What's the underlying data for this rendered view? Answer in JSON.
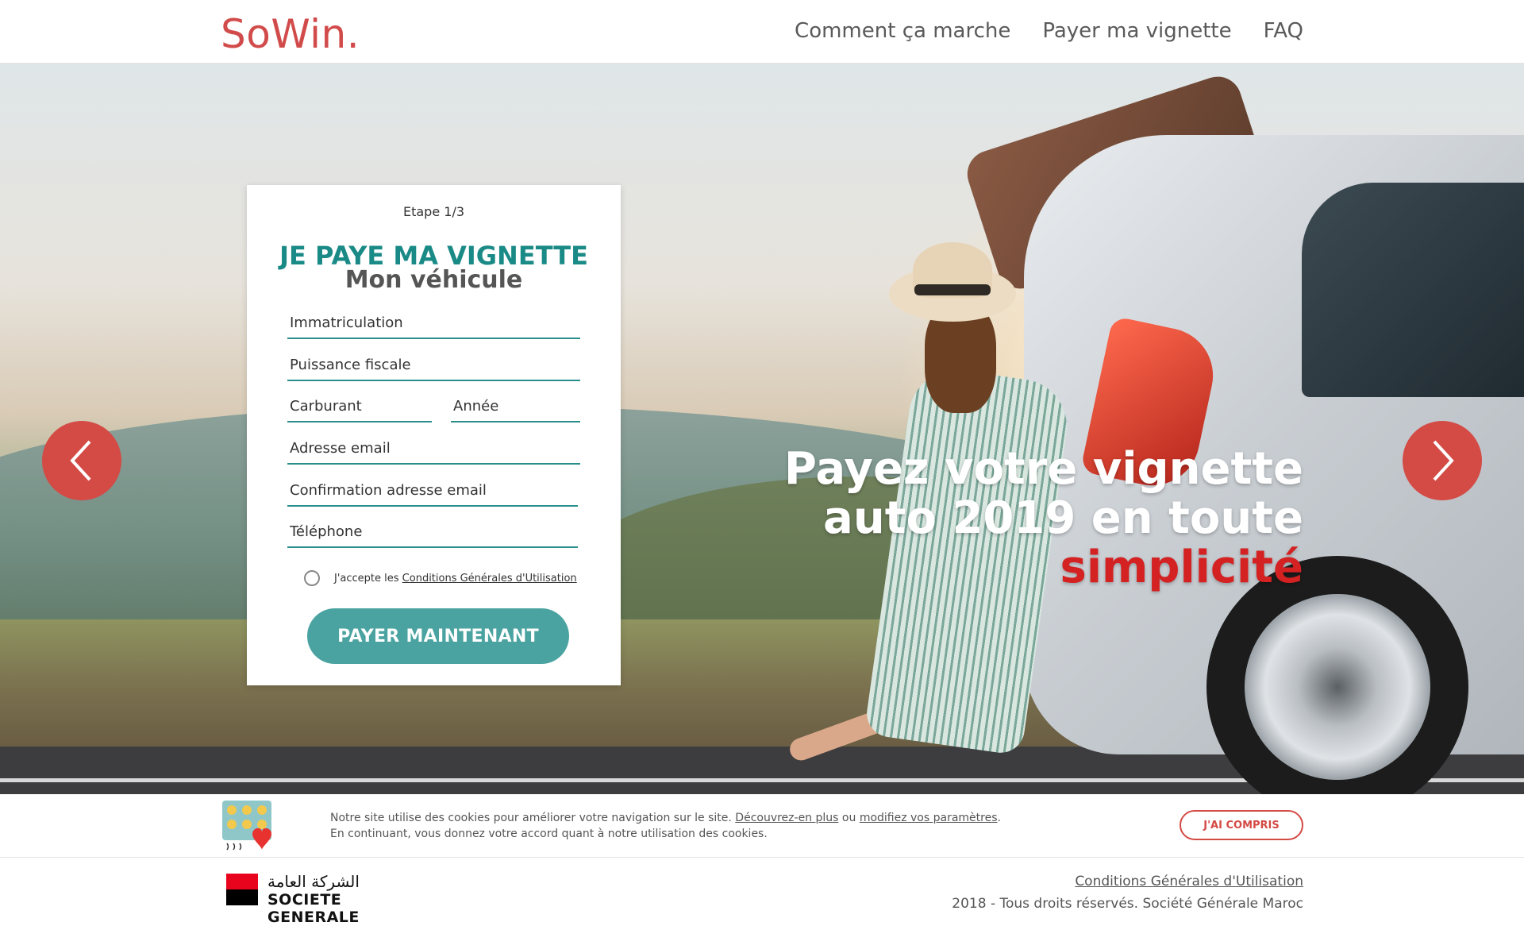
{
  "header": {
    "logo": "SoWin.",
    "nav": [
      "Comment ça marche",
      "Payer ma vignette",
      "FAQ"
    ]
  },
  "form": {
    "step": "Etape 1/3",
    "title": "JE PAYE MA VIGNETTE",
    "subtitle": "Mon véhicule",
    "fields": {
      "immatriculation": "Immatriculation",
      "puissance": "Puissance fiscale",
      "carburant": "Carburant",
      "annee": "Année",
      "email": "Adresse email",
      "email_confirm": "Confirmation adresse email",
      "telephone": "Téléphone"
    },
    "accept_prefix": "J'accepte les",
    "accept_link": "Conditions Générales d'Utilisation",
    "submit_label": "PAYER MAINTENANT"
  },
  "hero": {
    "line1": "Payez votre vignette",
    "line2": "auto 2019 en toute",
    "accent": "simplicité"
  },
  "cookie": {
    "text1": "Notre site utilise des cookies pour améliorer votre navigation sur le site.",
    "link1": "Découvrez-en plus",
    "ou": "ou",
    "link2": "modifiez vos paramètres",
    "text2": "En continuant, vous donnez votre accord quant à notre utilisation des cookies.",
    "button": "J'AI COMPRIS"
  },
  "footer": {
    "brand_arabic": "الشركة العامة",
    "brand_name": "SOCIETE GENERALE",
    "cgu_link": "Conditions Générales d'Utilisation",
    "copyright": "2018 - Tous droits réservés. Société Générale Maroc"
  },
  "colors": {
    "brand_red": "#d24b4b",
    "teal": "#1a8a87",
    "button_teal": "#4aa3a0",
    "arrow_red": "#d44a45"
  },
  "icons": [
    "chevron-left-icon",
    "chevron-right-icon",
    "cookie-consent-icon"
  ]
}
